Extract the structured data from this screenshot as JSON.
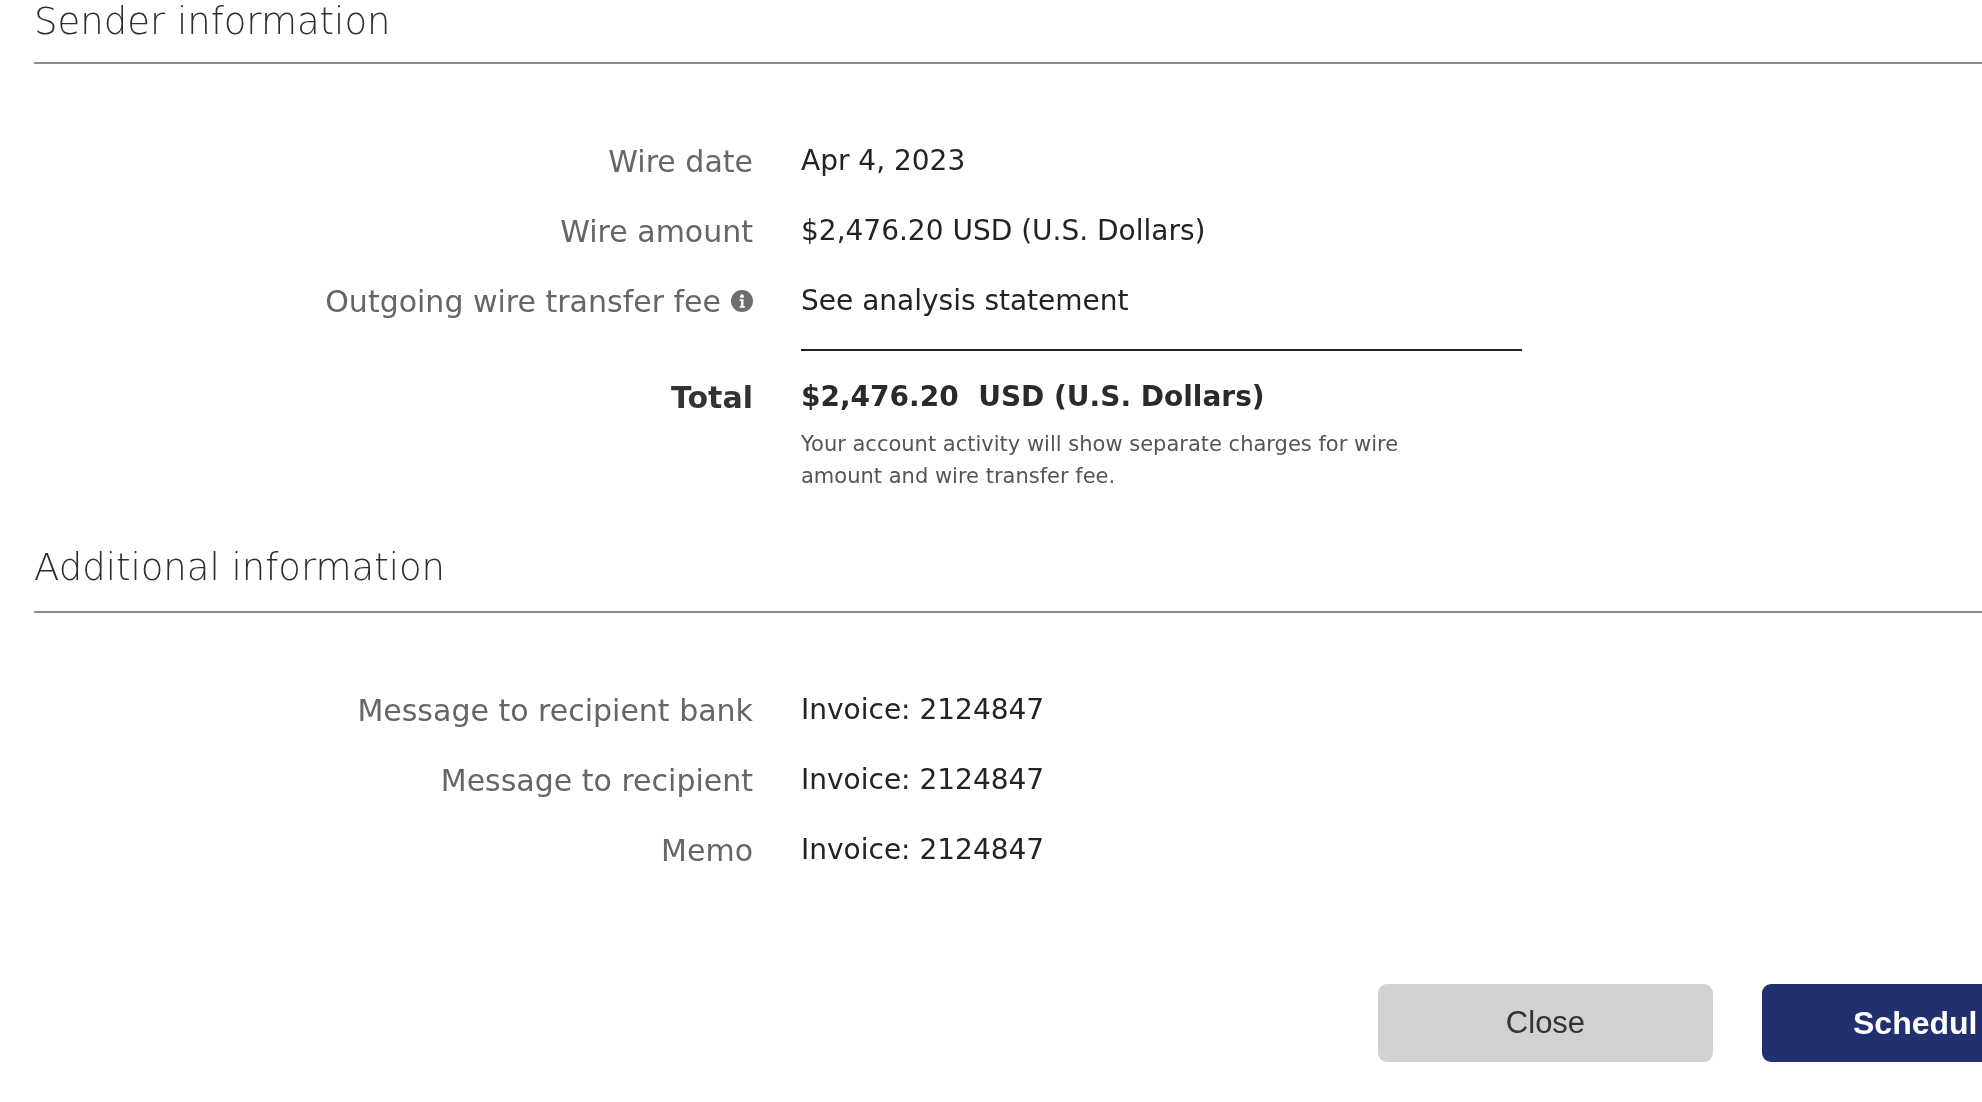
{
  "sections": [
    {
      "title": "Sender information",
      "rows": [
        {
          "kind": "plain",
          "label": "Wire date",
          "value": "Apr 4, 2023"
        },
        {
          "kind": "plain",
          "label": "Wire amount",
          "value": "$2,476.20 USD (U.S. Dollars)"
        },
        {
          "kind": "info",
          "label": "Outgoing wire transfer fee",
          "value": "See analysis statement"
        },
        {
          "kind": "total",
          "label": "Total",
          "value": "$2,476.20  USD (U.S. Dollars)",
          "note": "Your account activity will show separate charges for wire amount and wire transfer fee."
        }
      ]
    },
    {
      "title": "Additional information",
      "rows": [
        {
          "kind": "plain",
          "label": "Message to recipient bank",
          "value": "Invoice: 2124847"
        },
        {
          "kind": "plain",
          "label": "Message to recipient",
          "value": "Invoice: 2124847"
        },
        {
          "kind": "plain",
          "label": "Memo",
          "value": "Invoice: 2124847"
        }
      ]
    }
  ],
  "buttons": [
    {
      "kind": "secondary",
      "label": "Close"
    },
    {
      "kind": "primary",
      "label": "Schedul"
    }
  ]
}
